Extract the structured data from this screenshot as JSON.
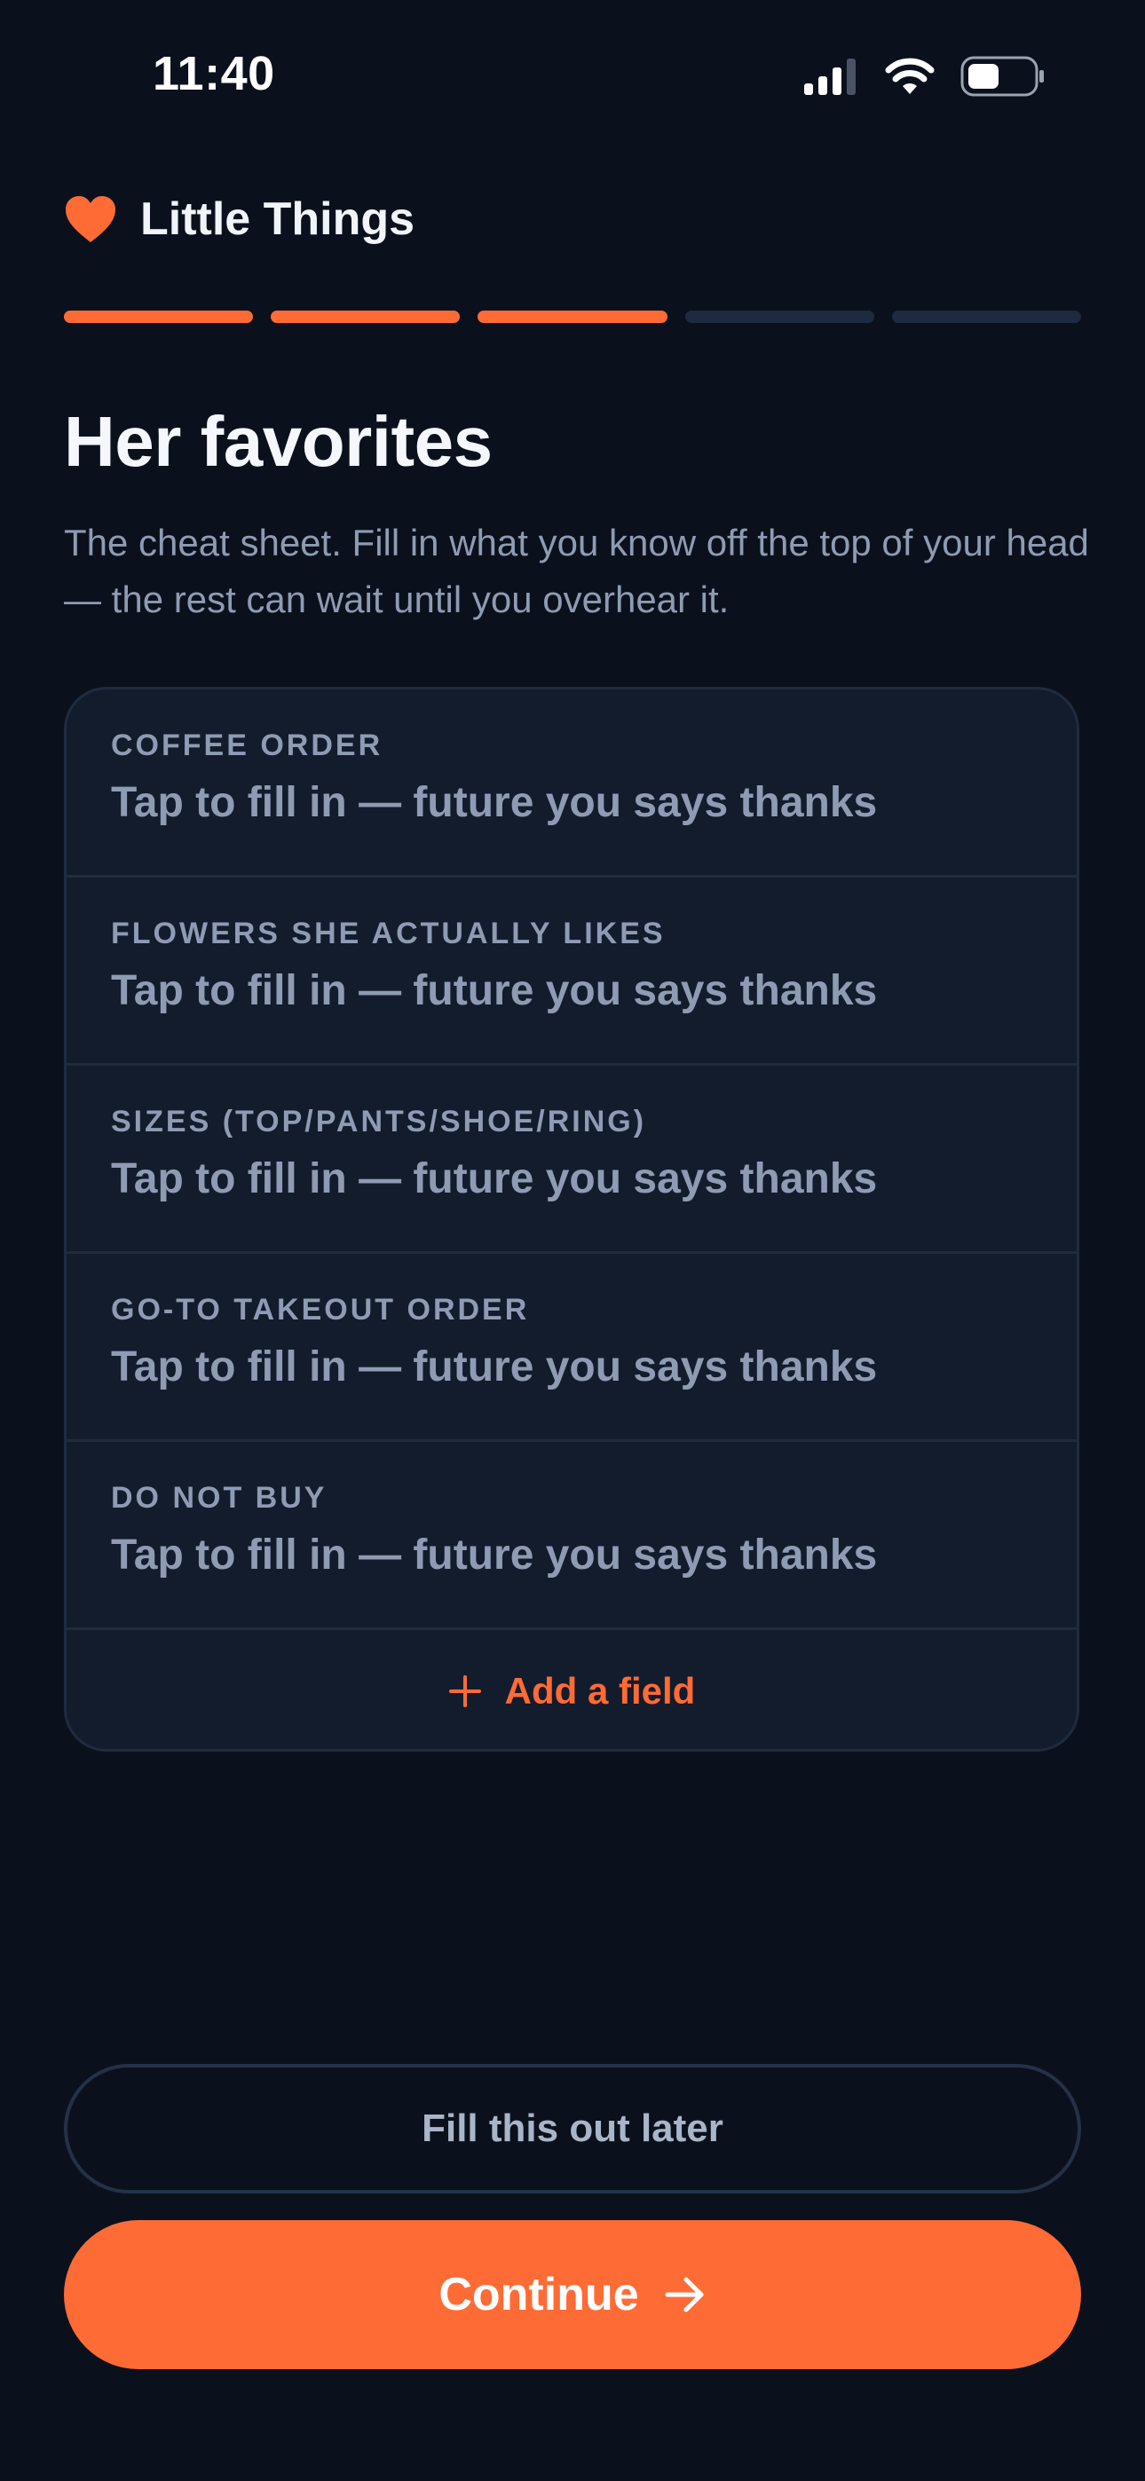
{
  "status_bar": {
    "time": "11:40"
  },
  "brand": {
    "name": "Little Things",
    "icon": "heart-icon",
    "accent_color": "#FF6B35"
  },
  "progress": {
    "total_steps": 5,
    "completed_steps": 3
  },
  "page": {
    "title": "Her favorites",
    "subtitle": "The cheat sheet. Fill in what you know off the top of your head — the rest can wait until you overhear it."
  },
  "fields": [
    {
      "label": "COFFEE ORDER",
      "placeholder": "Tap to fill in — future you says thanks"
    },
    {
      "label": "FLOWERS SHE ACTUALLY LIKES",
      "placeholder": "Tap to fill in — future you says thanks"
    },
    {
      "label": "SIZES (TOP/PANTS/SHOE/RING)",
      "placeholder": "Tap to fill in — future you says thanks"
    },
    {
      "label": "GO-TO TAKEOUT ORDER",
      "placeholder": "Tap to fill in — future you says thanks"
    },
    {
      "label": "DO NOT BUY",
      "placeholder": "Tap to fill in — future you says thanks"
    }
  ],
  "add_field": {
    "label": "Add a field",
    "icon": "plus-icon"
  },
  "actions": {
    "later_label": "Fill this out later",
    "continue_label": "Continue",
    "continue_icon": "arrow-right-icon"
  },
  "colors": {
    "background": "#0B111C",
    "card": "#131C2C",
    "accent": "#FF6B35",
    "muted_text": "#8E9BB3"
  }
}
